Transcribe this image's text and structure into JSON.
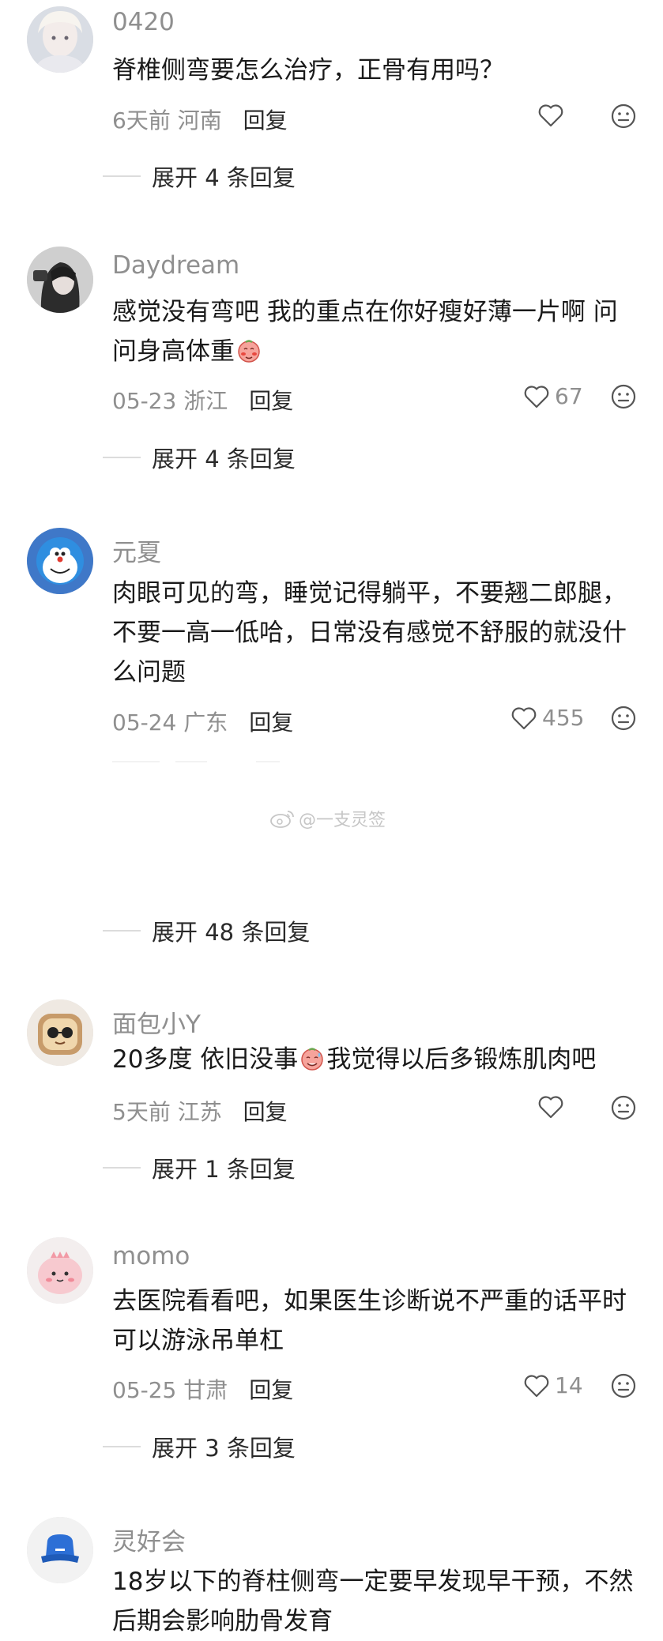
{
  "comments": [
    {
      "username": "0420",
      "lines": [
        "脊椎侧弯要怎么治疗，正骨有用吗？"
      ],
      "time": "6天前",
      "location": "河南",
      "reply_label": "回复",
      "likes": "",
      "expand": "展开 4 条回复"
    },
    {
      "username": "Daydream",
      "lines": [
        "感觉没有弯吧 我的重点在你好瘦好薄一片啊 问",
        "问身高体重"
      ],
      "emoji": "blush-face-emoji",
      "time": "05-23",
      "location": "浙江",
      "reply_label": "回复",
      "likes": "67",
      "expand": "展开 4 条回复"
    },
    {
      "username": "元夏",
      "lines": [
        "肉眼可见的弯，睡觉记得躺平，不要翘二郎腿，",
        "不要一高一低哈，日常没有感觉不舒服的就没什",
        "么问题"
      ],
      "time": "05-24",
      "location": "广东",
      "reply_label": "回复",
      "likes": "455",
      "expand": "展开 48 条回复"
    },
    {
      "username": "面包小Y",
      "line_before_emoji": "20多度 依旧没事",
      "line_after_emoji": "我觉得以后多锻炼肌肉吧",
      "emoji": "sweat-face-emoji",
      "time": "5天前",
      "location": "江苏",
      "reply_label": "回复",
      "likes": "",
      "expand": "展开 1 条回复"
    },
    {
      "username": "momo",
      "lines": [
        "去医院看看吧，如果医生诊断说不严重的话平时",
        "可以游泳吊单杠"
      ],
      "time": "05-25",
      "location": "甘肃",
      "reply_label": "回复",
      "likes": "14",
      "expand": "展开 3 条回复"
    },
    {
      "username": "灵好会",
      "lines": [
        "18岁以下的脊柱侧弯一定要早发现早干预，不然",
        "后期会影响肋骨发育"
      ]
    }
  ],
  "watermark": "@一支灵签",
  "colors": {
    "meta_gray": "#8f8f8f",
    "text": "#1a1a1a",
    "like_icon": "#555555"
  }
}
